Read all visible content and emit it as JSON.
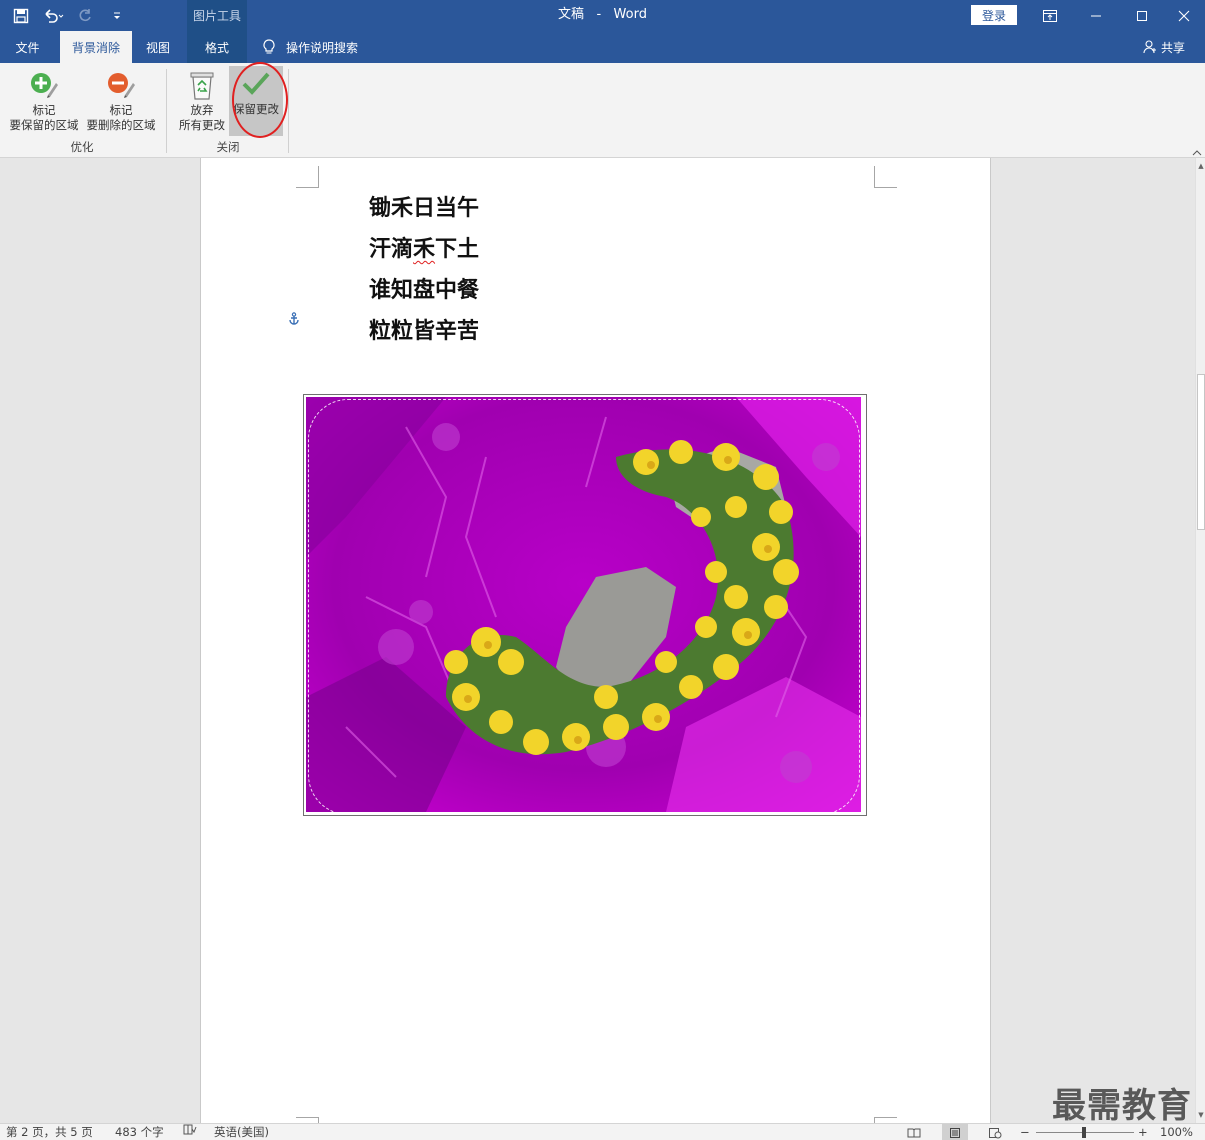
{
  "titlebar": {
    "doc_name": "文稿",
    "separator": "-",
    "app_name": "Word",
    "context_group": "图片工具",
    "login": "登录"
  },
  "tabs": [
    {
      "label": "文件"
    },
    {
      "label": "背景消除"
    },
    {
      "label": "视图"
    },
    {
      "label": "格式"
    }
  ],
  "search": {
    "label": "操作说明搜索"
  },
  "share": {
    "label": "共享"
  },
  "ribbon": {
    "mark_keep": {
      "line1": "标记",
      "line2": "要保留的区域"
    },
    "mark_remove": {
      "line1": "标记",
      "line2": "要删除的区域"
    },
    "group_refine": "优化",
    "discard": {
      "line1": "放弃",
      "line2": "所有更改"
    },
    "keep_changes": {
      "label": "保留更改"
    },
    "group_close": "关闭"
  },
  "document": {
    "poem": [
      "锄禾日当午",
      "汗滴禾下土",
      "谁知盘中餐",
      "粒粒皆辛苦"
    ],
    "poem_line2_parts": [
      "汗滴",
      "禾",
      "下土"
    ]
  },
  "statusbar": {
    "page": "第 2 页，共 5 页",
    "words": "483 个字",
    "language": "英语(美国)",
    "zoom": "100%",
    "zoom_minus": "−",
    "zoom_plus": "+"
  },
  "watermark": "最需教育",
  "colors": {
    "titlebar": "#2b579a",
    "removal_overlay": "#cc00cc",
    "flowers": "#f0d020",
    "highlight_circle": "#e02020"
  }
}
